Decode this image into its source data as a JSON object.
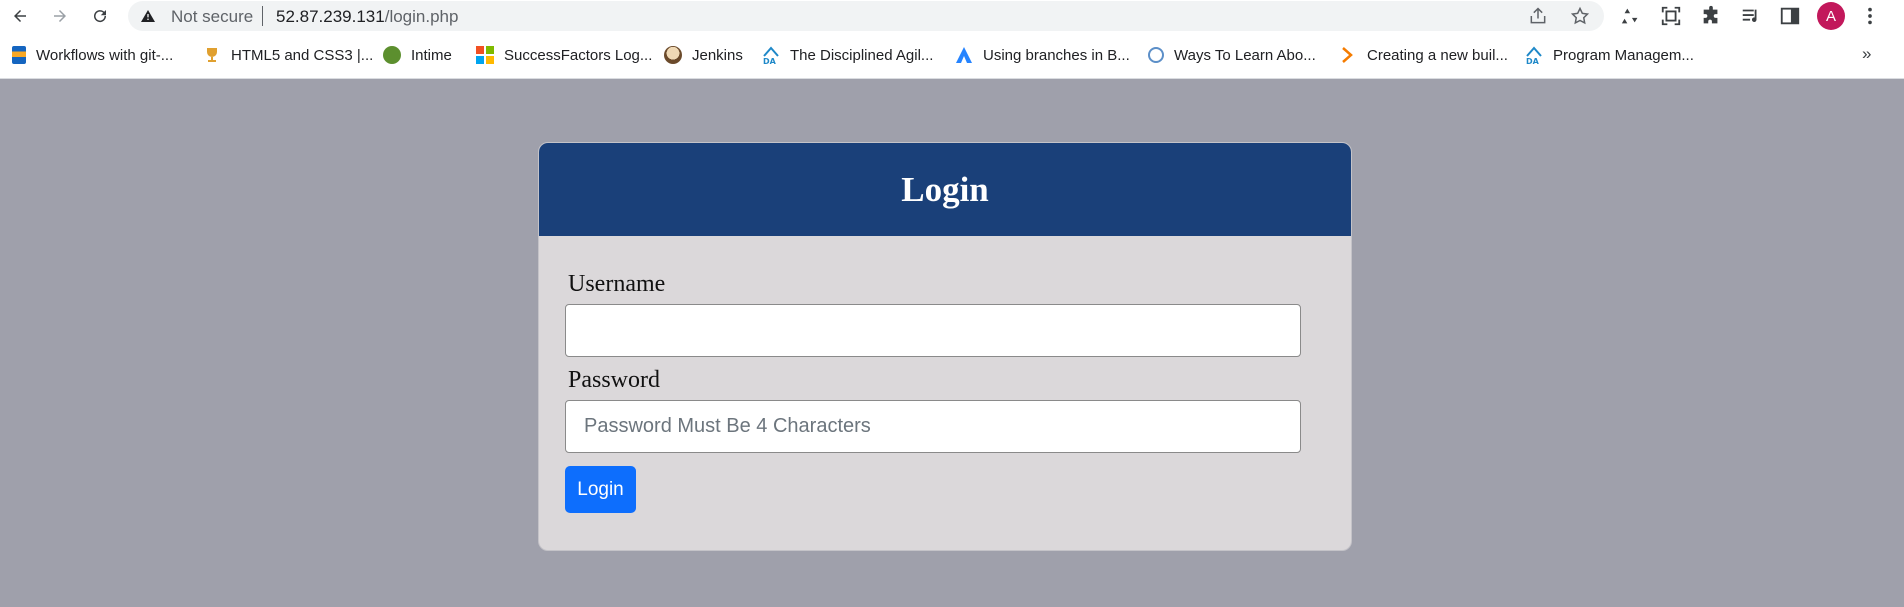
{
  "browser": {
    "security_label": "Not secure",
    "url_host": "52.87.239.131",
    "url_path": "/login.php",
    "profile_initial": "A",
    "bookmarks": [
      {
        "label": "Workflows with git-...",
        "icon": "git-book-icon"
      },
      {
        "label": "HTML5 and CSS3 |...",
        "icon": "trophy-icon"
      },
      {
        "label": "Intime",
        "icon": "intime-icon"
      },
      {
        "label": "SuccessFactors Log...",
        "icon": "microsoft-icon"
      },
      {
        "label": "Jenkins",
        "icon": "jenkins-icon"
      },
      {
        "label": "The Disciplined Agil...",
        "icon": "disciplined-agile-icon"
      },
      {
        "label": "Using branches in B...",
        "icon": "atlassian-icon"
      },
      {
        "label": "Ways To Learn Abo...",
        "icon": "globe-icon"
      },
      {
        "label": "Creating a new buil...",
        "icon": "chevron-orange-icon"
      },
      {
        "label": "Program Managem...",
        "icon": "disciplined-agile-icon"
      }
    ],
    "more_bookmarks": "»"
  },
  "login_form": {
    "title": "Login",
    "username_label": "Username",
    "username_value": "",
    "password_label": "Password",
    "password_placeholder": "Password Must Be 4 Characters",
    "submit_label": "Login"
  },
  "colors": {
    "page_background": "#9fa0ab",
    "card_background": "#dbd8da",
    "header_background": "#1a4079",
    "button_primary": "#0d6efd",
    "avatar": "#c2185b"
  }
}
